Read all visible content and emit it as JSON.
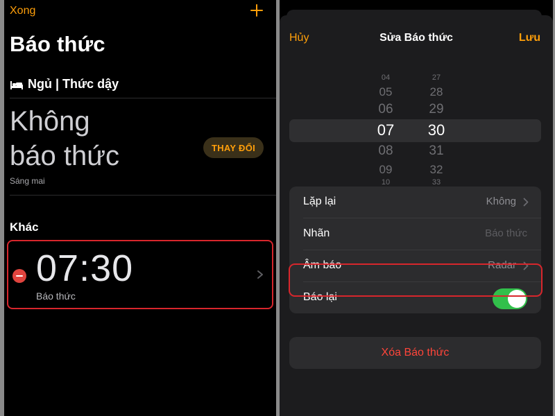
{
  "left": {
    "done_label": "Xong",
    "title": "Báo thức",
    "sleep_section_label": "Ngủ | Thức dậy",
    "no_alarm_line1": "Không",
    "no_alarm_line2": "báo thức",
    "tomorrow_label": "Sáng mai",
    "change_button_label": "THAY ĐỔI",
    "other_section_label": "Khác",
    "alarm": {
      "time": "07:30",
      "label": "Báo thức"
    }
  },
  "right": {
    "cancel_label": "Hủy",
    "title": "Sửa Báo thức",
    "save_label": "Lưu",
    "picker": {
      "hours": [
        "04",
        "05",
        "06",
        "07",
        "08",
        "09",
        "10"
      ],
      "minutes": [
        "27",
        "28",
        "29",
        "30",
        "31",
        "32",
        "33"
      ],
      "selected_hour": "07",
      "selected_minute": "30"
    },
    "rows": {
      "repeat": {
        "label": "Lặp lại",
        "value": "Không"
      },
      "label": {
        "label": "Nhãn",
        "placeholder": "Báo thức"
      },
      "sound": {
        "label": "Âm báo",
        "value": "Radar"
      },
      "snooze": {
        "label": "Báo lại",
        "enabled": true
      }
    },
    "delete_label": "Xóa Báo thức"
  },
  "colors": {
    "accent": "#ff9f0a",
    "highlight": "#d8262c",
    "toggle_on": "#32c04b",
    "destructive": "#ff453a"
  }
}
